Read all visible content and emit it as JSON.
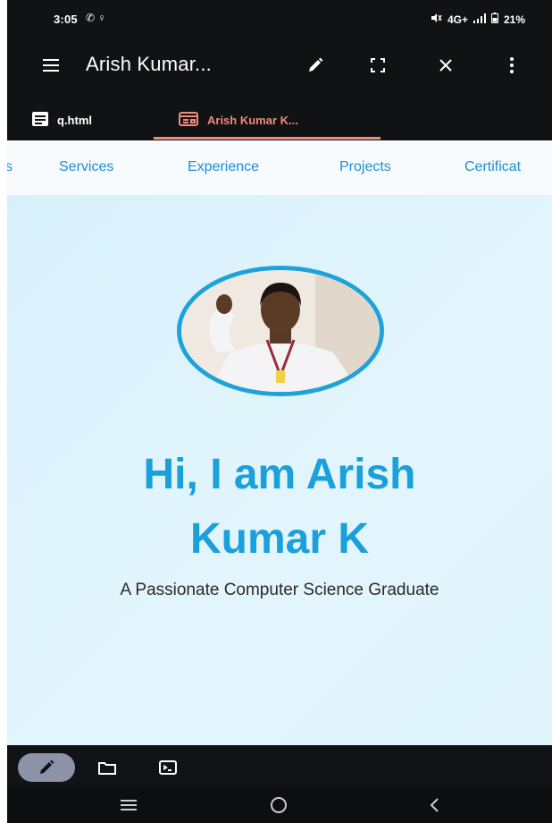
{
  "status_bar": {
    "time": "3:05",
    "app_icons": "✆ ♀",
    "network": "4G+",
    "battery": "21%"
  },
  "toolbar": {
    "title": "Arish Kumar...",
    "icons": [
      "menu-icon",
      "pencil-icon",
      "fullscreen-icon",
      "close-icon",
      "more-vert-icon"
    ]
  },
  "tabs": [
    {
      "label": "q.html",
      "icon": "document-icon",
      "active": false
    },
    {
      "label": "Arish Kumar K...",
      "icon": "browser-tab-icon",
      "active": true
    }
  ],
  "site_nav": {
    "partial_left": "s",
    "items": [
      "Services",
      "Experience",
      "Projects",
      "Certificat"
    ]
  },
  "hero": {
    "title_line1": "Hi, I am Arish",
    "title_line2": "Kumar K",
    "subtitle": "A Passionate Computer Science Graduate"
  },
  "bottom_bar": {
    "icons": [
      "pencil-icon",
      "folder-icon",
      "terminal-icon"
    ]
  },
  "system_nav": {
    "icons": [
      "recents-icon",
      "home-icon",
      "back-icon"
    ]
  },
  "colors": {
    "accent": "#1aa0db",
    "tab_active": "#f08a7a",
    "nav_link": "#1f8ed1",
    "hero_bg": "#dcf2fb"
  }
}
